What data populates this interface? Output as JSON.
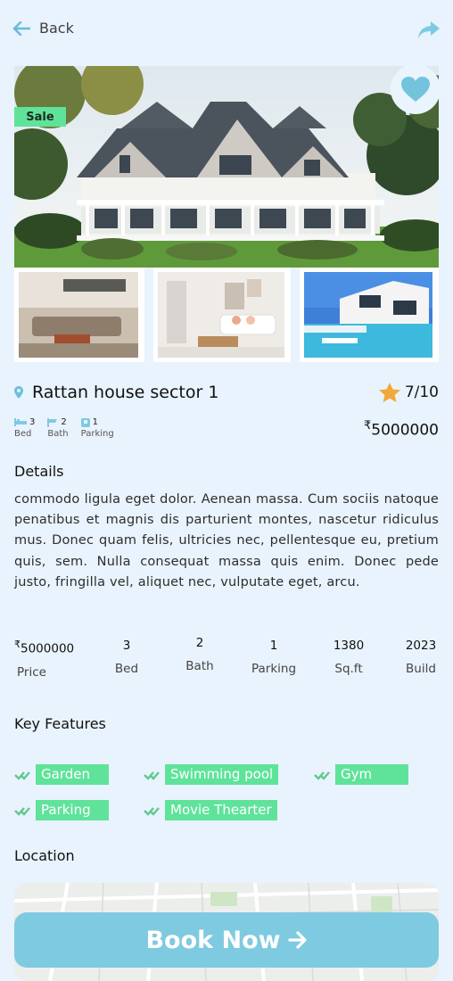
{
  "header": {
    "back_label": "Back"
  },
  "property": {
    "badge": "Sale",
    "title": "Rattan house sector 1",
    "rating": "7/10",
    "price": "5000000",
    "currency_symbol": "₹",
    "meta": [
      {
        "value": "3",
        "label": "Bed",
        "icon": "bed-icon"
      },
      {
        "value": "2",
        "label": "Bath",
        "icon": "bath-icon"
      },
      {
        "value": "1",
        "label": "Parking",
        "icon": "parking-icon"
      }
    ]
  },
  "details": {
    "heading": "Details",
    "text": "commodo ligula eget dolor. Aenean massa. Cum sociis natoque penatibus et magnis dis parturient montes, nascetur ridiculus mus. Donec quam felis, ultricies nec, pellentesque eu, pretium quis, sem. Nulla consequat massa quis enim. Donec pede justo, fringilla vel, aliquet nec, vulputate eget, arcu."
  },
  "stats": [
    {
      "value": "5000000",
      "label": "Price"
    },
    {
      "value": "3",
      "label": "Bed"
    },
    {
      "value": "2",
      "label": "Bath"
    },
    {
      "value": "1",
      "label": "Parking"
    },
    {
      "value": "1380",
      "label": "Sq.ft"
    },
    {
      "value": "2023",
      "label": "Build"
    }
  ],
  "features": {
    "heading": "Key Features",
    "items": [
      "Garden",
      "Swimming pool",
      "Gym",
      "Parking",
      "Movie Thearter"
    ]
  },
  "location": {
    "heading": "Location"
  },
  "cta": {
    "label": "Book Now"
  },
  "colors": {
    "background": "#e9f3fd",
    "accent": "#7ecae1",
    "feature_badge": "#5fe39a",
    "star": "#f2a93b"
  }
}
